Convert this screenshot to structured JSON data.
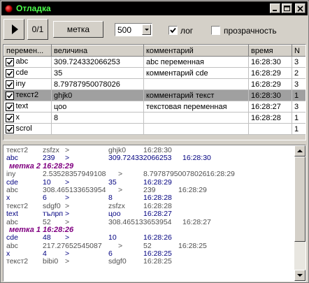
{
  "window": {
    "title": "Отладка"
  },
  "toolbar": {
    "zero_label": "0/1",
    "mark_label": "метка",
    "interval_value": "500",
    "log_label": "лог",
    "log_checked": true,
    "transparency_label": "прозрачность",
    "transparency_checked": false
  },
  "grid": {
    "columns": [
      "перемен...",
      "величина",
      "комментарий",
      "время",
      "N"
    ],
    "rows": [
      {
        "checked": true,
        "name": "abc",
        "value": "309.724332066253",
        "comment": "abc переменная",
        "time": "16:28:30",
        "n": "3"
      },
      {
        "checked": true,
        "name": "cde",
        "value": "35",
        "comment": "комментарий  cde",
        "time": "16:28:29",
        "n": "2"
      },
      {
        "checked": true,
        "name": "iny",
        "value": "8.79787950078026",
        "comment": "",
        "time": "16:28:29",
        "n": "3"
      },
      {
        "checked": true,
        "name": "текст2",
        "value": "ghjk0",
        "comment": "комментарий  текст",
        "time": "16:28:30",
        "n": "1",
        "selected": true
      },
      {
        "checked": true,
        "name": "text",
        "value": "цоо",
        "comment": "текстовая     переменная",
        "time": "16:28:27",
        "n": "3"
      },
      {
        "checked": true,
        "name": "x",
        "value": "8",
        "comment": "",
        "time": "16:28:28",
        "n": "1"
      },
      {
        "checked": true,
        "name": "scrol",
        "value": "",
        "comment": "",
        "time": "",
        "n": "1"
      }
    ]
  },
  "log": {
    "lines": [
      {
        "kind": "entry",
        "color": "gray",
        "name": "текст2",
        "v1": "zsfzx",
        "arrow": ">",
        "v2": "ghjk0",
        "time": "16:28:30"
      },
      {
        "kind": "entry",
        "color": "blue",
        "name": "abc",
        "v1": "239",
        "arrow": ">",
        "v2": "309.724332066253",
        "time": "16:28:30"
      },
      {
        "kind": "mark",
        "text": "метка 2 16:28:29"
      },
      {
        "kind": "entry",
        "color": "gray",
        "name": "iny",
        "v1": "2.53528357949108",
        "arrow": ">",
        "v2": "8.79787950078026",
        "time": "16:28:29",
        "wide": true
      },
      {
        "kind": "entry",
        "color": "blue",
        "name": "cde",
        "v1": "10",
        "arrow": ">",
        "v2": "35",
        "time": "16:28:29"
      },
      {
        "kind": "entry",
        "color": "gray",
        "name": "abc",
        "v1": "308.465133653954",
        "arrow": ">",
        "v2": "239",
        "time": "16:28:29",
        "wide": true
      },
      {
        "kind": "entry",
        "color": "blue",
        "name": "x",
        "v1": "6",
        "arrow": ">",
        "v2": "8",
        "time": "16:28:28"
      },
      {
        "kind": "entry",
        "color": "gray",
        "name": "текст2",
        "v1": "sdgf0",
        "arrow": ">",
        "v2": "zsfzx",
        "time": "16:28:28"
      },
      {
        "kind": "entry",
        "color": "blue",
        "name": "text",
        "v1": "тълрп",
        "arrow": ">",
        "v2": "цоо",
        "time": "16:28:27"
      },
      {
        "kind": "entry",
        "color": "gray",
        "name": "abc",
        "v1": "52",
        "arrow": ">",
        "v2": "308.465133653954",
        "time": "16:28:27"
      },
      {
        "kind": "mark",
        "text": "метка 1 16:28:26"
      },
      {
        "kind": "entry",
        "color": "blue",
        "name": "cde",
        "v1": "48",
        "arrow": ">",
        "v2": "10",
        "time": "16:28:26"
      },
      {
        "kind": "entry",
        "color": "gray",
        "name": "abc",
        "v1": "217.27652545087",
        "arrow": ">",
        "v2": "52",
        "time": "16:28:25",
        "wide": true
      },
      {
        "kind": "entry",
        "color": "blue",
        "name": "x",
        "v1": "4",
        "arrow": ">",
        "v2": "6",
        "time": "16:28:25"
      },
      {
        "kind": "entry",
        "color": "gray",
        "name": "текст2",
        "v1": "bibi0",
        "arrow": ">",
        "v2": "sdgf0",
        "time": "16:28:25"
      }
    ]
  }
}
